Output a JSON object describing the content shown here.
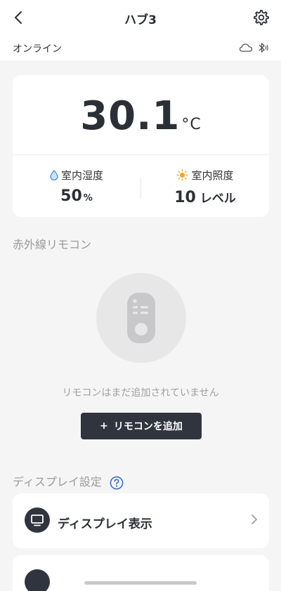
{
  "header": {
    "title": "ハブ3",
    "status": "オンライン"
  },
  "sensors": {
    "temperature": {
      "value": "30.1",
      "unit": "°C"
    },
    "humidity": {
      "label": "室内湿度",
      "value": "50",
      "unit": "%"
    },
    "light": {
      "label": "室内照度",
      "value": "10",
      "unit": "レベル"
    }
  },
  "remote_section": {
    "title": "赤外線リモコン",
    "empty_text": "リモコンはまだ追加されていません",
    "add_button": {
      "plus": "+",
      "label": "リモコンを追加"
    }
  },
  "display_section": {
    "title": "ディスプレイ設定",
    "items": [
      {
        "label": "ディスプレイ表示"
      }
    ]
  },
  "colors": {
    "accent_dark": "#30343e",
    "background": "#f5f5f5",
    "droplet": "#3a8be8",
    "sun": "#f5a623",
    "help": "#3b6fd0"
  },
  "icons": {
    "back": "chevron-left-icon",
    "settings": "gear-icon",
    "cloud": "cloud-icon",
    "bluetooth": "bluetooth-icon",
    "humidity": "droplet-icon",
    "light": "sun-icon",
    "remote": "remote-control-icon",
    "help": "help-icon",
    "display": "monitor-icon",
    "chevron": "chevron-right-icon"
  }
}
